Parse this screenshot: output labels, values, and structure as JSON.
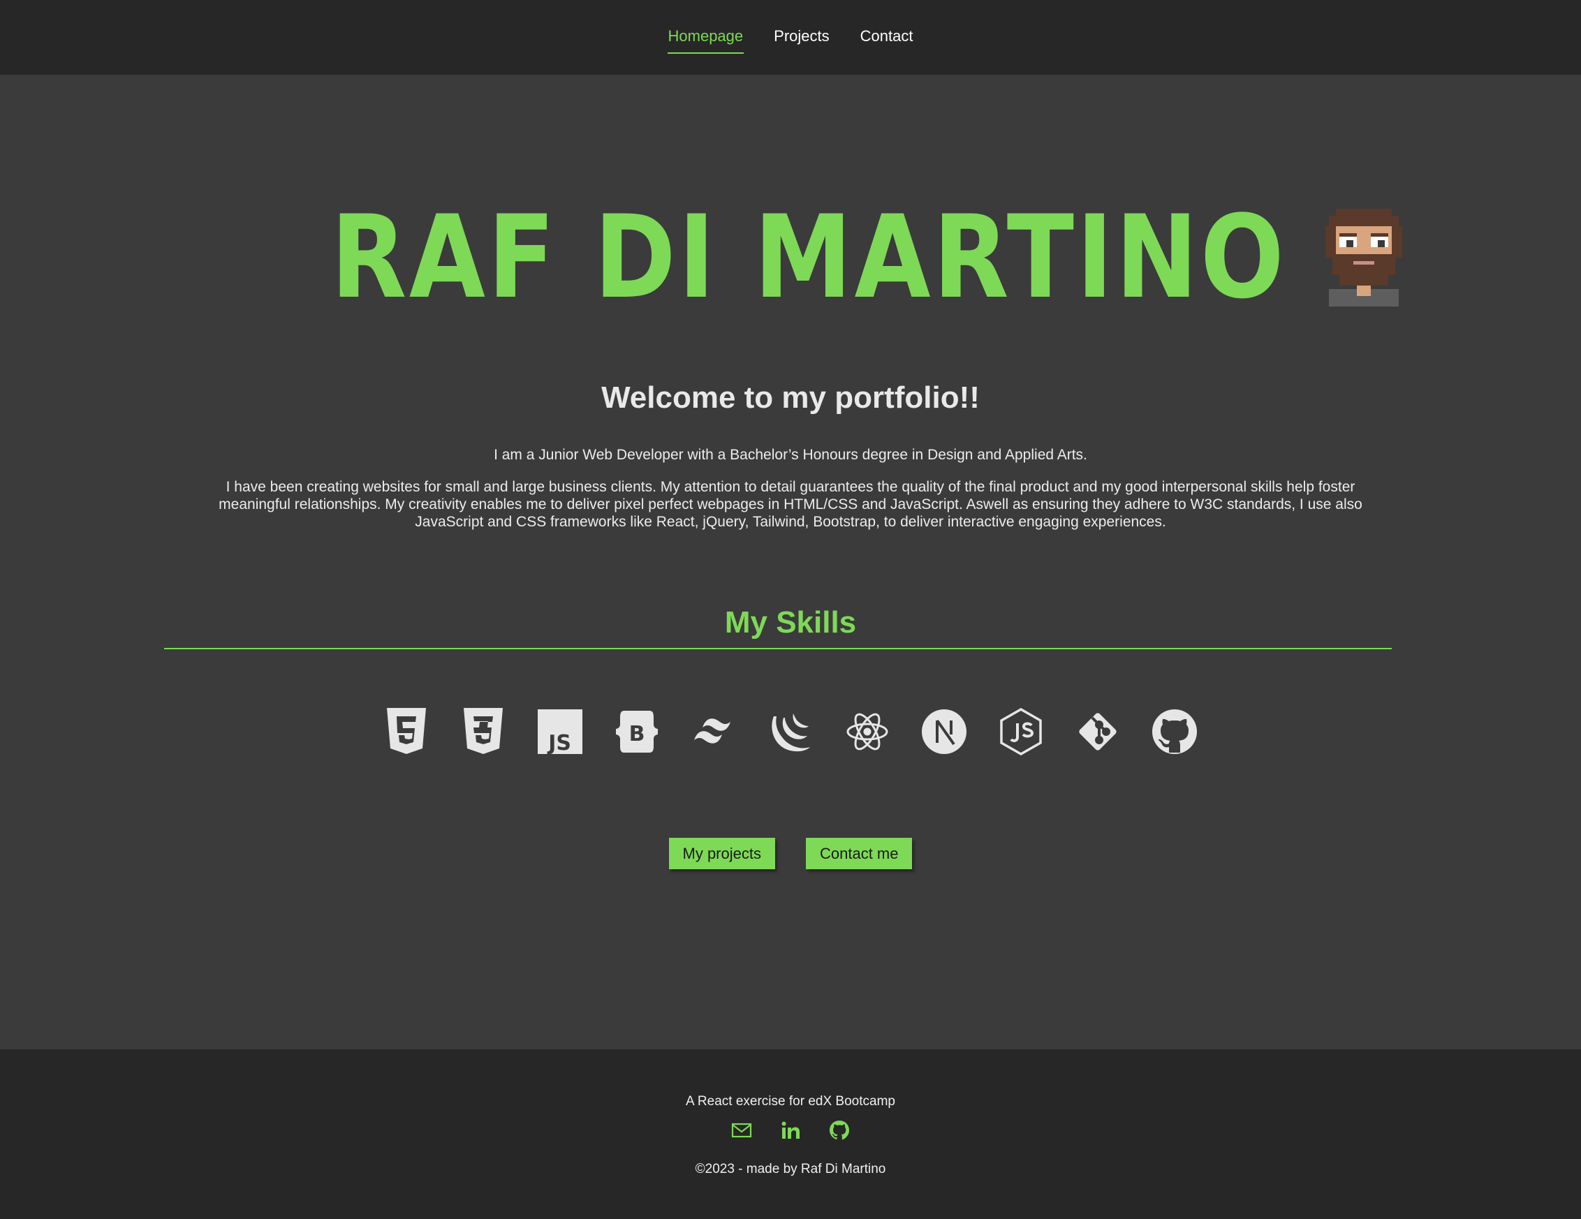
{
  "nav": {
    "items": [
      {
        "label": "Homepage",
        "active": true
      },
      {
        "label": "Projects",
        "active": false
      },
      {
        "label": "Contact",
        "active": false
      }
    ]
  },
  "hero": {
    "title": "RAF DI MARTINO",
    "avatar_icon": "pixel-avatar-icon"
  },
  "welcome": {
    "title": "Welcome to my portfolio!!",
    "intro": "I am a Junior Web Developer with a Bachelor’s Honours degree in Design and Applied Arts.",
    "bio": "I have been creating websites for small and large business clients. My attention to detail guarantees the quality of the final product and my good interpersonal skills help foster meaningful relationships. My creativity enables me to deliver pixel perfect webpages in HTML/CSS and JavaScript. Aswell as ensuring they adhere to W3C standards, I use also JavaScript and CSS frameworks like React, jQuery, Tailwind, Bootstrap, to deliver interactive engaging experiences."
  },
  "skills": {
    "title": "My Skills",
    "icons": [
      "html5-icon",
      "css3-icon",
      "javascript-icon",
      "bootstrap-icon",
      "tailwind-icon",
      "jquery-icon",
      "react-icon",
      "nextjs-icon",
      "nodejs-icon",
      "git-icon",
      "github-icon"
    ]
  },
  "buttons": {
    "projects_label": "My projects",
    "contact_label": "Contact me"
  },
  "footer": {
    "note": "A React exercise for edX Bootcamp",
    "social_icons": [
      "email-icon",
      "linkedin-icon",
      "github-icon"
    ],
    "copyright": "©2023 - made by Raf Di Martino"
  },
  "colors": {
    "accent": "#7ed957",
    "background": "#3b3b3b",
    "header_footer": "#272727",
    "text": "#ececec",
    "icon": "#e6e6e6"
  }
}
